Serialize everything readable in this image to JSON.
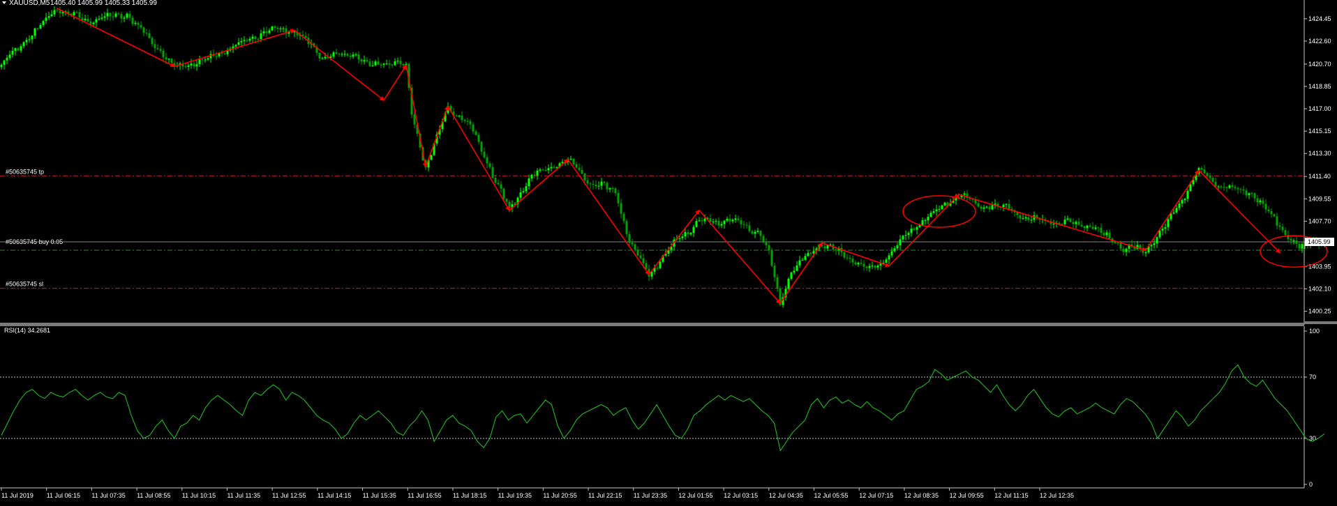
{
  "header": {
    "symbol": "XAUUSD,M5",
    "ohlc": "1405.40 1405.99 1405.33 1405.99"
  },
  "colors": {
    "background": "#000000",
    "axis": "#c8c8c8",
    "text": "#ffffff",
    "bull": "#00ff00",
    "bear": "#00a000",
    "arrow": "#ff0000",
    "level": "#d02020",
    "entry": "#2f8a2f",
    "current_price_line": "#8a8a8a",
    "rsi_line": "#22cc22",
    "rsi_level": "#c8c8c8"
  },
  "orders": {
    "tp_label": "#50635745 tp",
    "buy_label": "#50635745 buy 0.05",
    "sl_label": "#50635745 sl",
    "current_price_tag": "1405.99"
  },
  "rsi_panel": {
    "label": "RSI(14) 34.2681"
  },
  "chart_data": [
    {
      "type": "candlestick",
      "title": "XAUUSD,M5",
      "ylim": [
        1399.3,
        1426.0
      ],
      "y_ticks": [
        "1424.45",
        "1422.60",
        "1420.70",
        "1418.85",
        "1417.00",
        "1415.15",
        "1413.30",
        "1411.40",
        "1409.55",
        "1407.70",
        "1405.99",
        "1403.95",
        "1402.10",
        "1400.25"
      ],
      "x_ticks": [
        "11 Jul 2019",
        "11 Jul 06:15",
        "11 Jul 07:35",
        "11 Jul 08:55",
        "11 Jul 10:15",
        "11 Jul 11:35",
        "11 Jul 12:55",
        "11 Jul 14:15",
        "11 Jul 15:35",
        "11 Jul 16:55",
        "11 Jul 18:15",
        "11 Jul 19:35",
        "11 Jul 20:55",
        "11 Jul 22:15",
        "11 Jul 23:35",
        "12 Jul 01:55",
        "12 Jul 03:15",
        "12 Jul 04:35",
        "12 Jul 05:55",
        "12 Jul 07:15",
        "12 Jul 08:35",
        "12 Jul 09:55",
        "12 Jul 11:15",
        "12 Jul 12:35"
      ],
      "levels": {
        "tp": 1411.45,
        "entry": 1405.3,
        "sl": 1402.15,
        "current": 1405.99
      },
      "path_keypoints": [
        [
          0,
          1420.6
        ],
        [
          20,
          1425.3
        ],
        [
          30,
          1424.3
        ],
        [
          45,
          1424.8
        ],
        [
          62,
          1420.5
        ],
        [
          72,
          1420.9
        ],
        [
          80,
          1421.8
        ],
        [
          96,
          1423.5
        ],
        [
          105,
          1423.5
        ],
        [
          115,
          1421.3
        ],
        [
          127,
          1421.5
        ],
        [
          132,
          1420.5
        ],
        [
          142,
          1421.0
        ],
        [
          145,
          1420.4
        ],
        [
          147,
          1416.5
        ],
        [
          152,
          1412.2
        ],
        [
          155,
          1414.0
        ],
        [
          160,
          1417.2
        ],
        [
          168,
          1415.6
        ],
        [
          182,
          1408.6
        ],
        [
          190,
          1411.5
        ],
        [
          203,
          1412.8
        ],
        [
          210,
          1411.0
        ],
        [
          220,
          1410.2
        ],
        [
          225,
          1405.9
        ],
        [
          232,
          1403.3
        ],
        [
          242,
          1406.1
        ],
        [
          250,
          1407.7
        ],
        [
          257,
          1407.6
        ],
        [
          262,
          1407.9
        ],
        [
          268,
          1407.1
        ],
        [
          272,
          1406.7
        ],
        [
          275,
          1405.0
        ],
        [
          279,
          1400.9
        ],
        [
          283,
          1403.6
        ],
        [
          294,
          1405.9
        ],
        [
          302,
          1404.8
        ],
        [
          312,
          1403.7
        ],
        [
          318,
          1404.9
        ],
        [
          328,
          1407.4
        ],
        [
          343,
          1409.9
        ],
        [
          350,
          1409.0
        ],
        [
          360,
          1408.9
        ],
        [
          368,
          1407.9
        ],
        [
          380,
          1407.6
        ],
        [
          390,
          1407.4
        ],
        [
          402,
          1405.5
        ],
        [
          410,
          1405.3
        ],
        [
          418,
          1407.6
        ],
        [
          429,
          1411.9
        ],
        [
          437,
          1410.5
        ],
        [
          448,
          1410.1
        ],
        [
          458,
          1407.3
        ],
        [
          465,
          1405.4
        ],
        [
          470,
          1405.99
        ]
      ],
      "swing_arrows": [
        [
          [
            20,
            1425.3
          ],
          [
            62,
            1420.5
          ]
        ],
        [
          [
            62,
            1420.5
          ],
          [
            105,
            1423.5
          ]
        ],
        [
          [
            105,
            1423.5
          ],
          [
            137,
            1417.7
          ]
        ],
        [
          [
            137,
            1417.7
          ],
          [
            145,
            1420.6
          ]
        ],
        [
          [
            145,
            1420.6
          ],
          [
            152,
            1412.2
          ]
        ],
        [
          [
            152,
            1412.2
          ],
          [
            160,
            1417.2
          ]
        ],
        [
          [
            160,
            1417.2
          ],
          [
            182,
            1408.6
          ]
        ],
        [
          [
            182,
            1408.6
          ],
          [
            203,
            1412.8
          ]
        ],
        [
          [
            203,
            1412.8
          ],
          [
            232,
            1403.3
          ]
        ],
        [
          [
            232,
            1403.3
          ],
          [
            250,
            1408.6
          ]
        ],
        [
          [
            250,
            1408.6
          ],
          [
            279,
            1400.9
          ]
        ],
        [
          [
            279,
            1400.9
          ],
          [
            294,
            1405.9
          ]
        ],
        [
          [
            294,
            1405.9
          ],
          [
            318,
            1404.0
          ]
        ],
        [
          [
            318,
            1404.0
          ],
          [
            343,
            1409.9
          ]
        ],
        [
          [
            343,
            1409.9
          ],
          [
            410,
            1405.3
          ]
        ],
        [
          [
            410,
            1405.3
          ],
          [
            429,
            1411.9
          ]
        ],
        [
          [
            429,
            1411.9
          ],
          [
            458,
            1405.1
          ]
        ]
      ],
      "highlight_ellipses": [
        {
          "center": [
            336,
            1408.5
          ],
          "rx_bars": 13,
          "ry_price": 1.3
        },
        {
          "center": [
            463,
            1405.2
          ],
          "rx_bars": 12,
          "ry_price": 1.3
        }
      ]
    },
    {
      "type": "line",
      "title": "RSI(14) 34.2681",
      "ylim": [
        0,
        100
      ],
      "y_ticks": [
        100,
        70,
        30,
        0
      ],
      "levels": [
        70,
        30
      ],
      "series": [
        {
          "values": [
            32,
            40,
            48,
            55,
            60,
            62,
            58,
            56,
            60,
            58,
            57,
            60,
            62,
            58,
            55,
            58,
            60,
            57,
            56,
            60,
            58,
            45,
            35,
            30,
            32,
            38,
            42,
            35,
            30,
            38,
            40,
            45,
            42,
            50,
            55,
            58,
            55,
            52,
            48,
            45,
            55,
            60,
            58,
            62,
            65,
            62,
            55,
            60,
            58,
            55,
            50,
            45,
            42,
            40,
            36,
            30,
            33,
            40,
            45,
            42,
            45,
            48,
            44,
            40,
            34,
            32,
            38,
            42,
            48,
            42,
            28,
            35,
            42,
            45,
            40,
            38,
            35,
            28,
            24,
            30,
            44,
            48,
            42,
            45,
            46,
            40,
            45,
            50,
            55,
            52,
            38,
            30,
            35,
            42,
            46,
            48,
            50,
            52,
            50,
            45,
            48,
            50,
            42,
            36,
            40,
            46,
            52,
            45,
            38,
            32,
            30,
            36,
            45,
            48,
            52,
            55,
            58,
            55,
            58,
            56,
            54,
            56,
            52,
            48,
            45,
            40,
            22,
            28,
            34,
            38,
            42,
            52,
            56,
            50,
            55,
            57,
            53,
            55,
            52,
            50,
            54,
            50,
            48,
            45,
            42,
            46,
            48,
            55,
            62,
            64,
            67,
            75,
            72,
            68,
            70,
            72,
            74,
            70,
            68,
            64,
            60,
            65,
            58,
            52,
            48,
            52,
            58,
            62,
            56,
            50,
            46,
            44,
            48,
            50,
            46,
            48,
            50,
            53,
            50,
            48,
            46,
            52,
            56,
            54,
            50,
            46,
            40,
            30,
            36,
            42,
            48,
            44,
            38,
            42,
            48,
            52,
            56,
            60,
            66,
            74,
            78,
            70,
            66,
            64,
            68,
            62,
            56,
            52,
            48,
            42,
            36,
            30,
            28,
            30,
            33
          ]
        }
      ]
    }
  ]
}
